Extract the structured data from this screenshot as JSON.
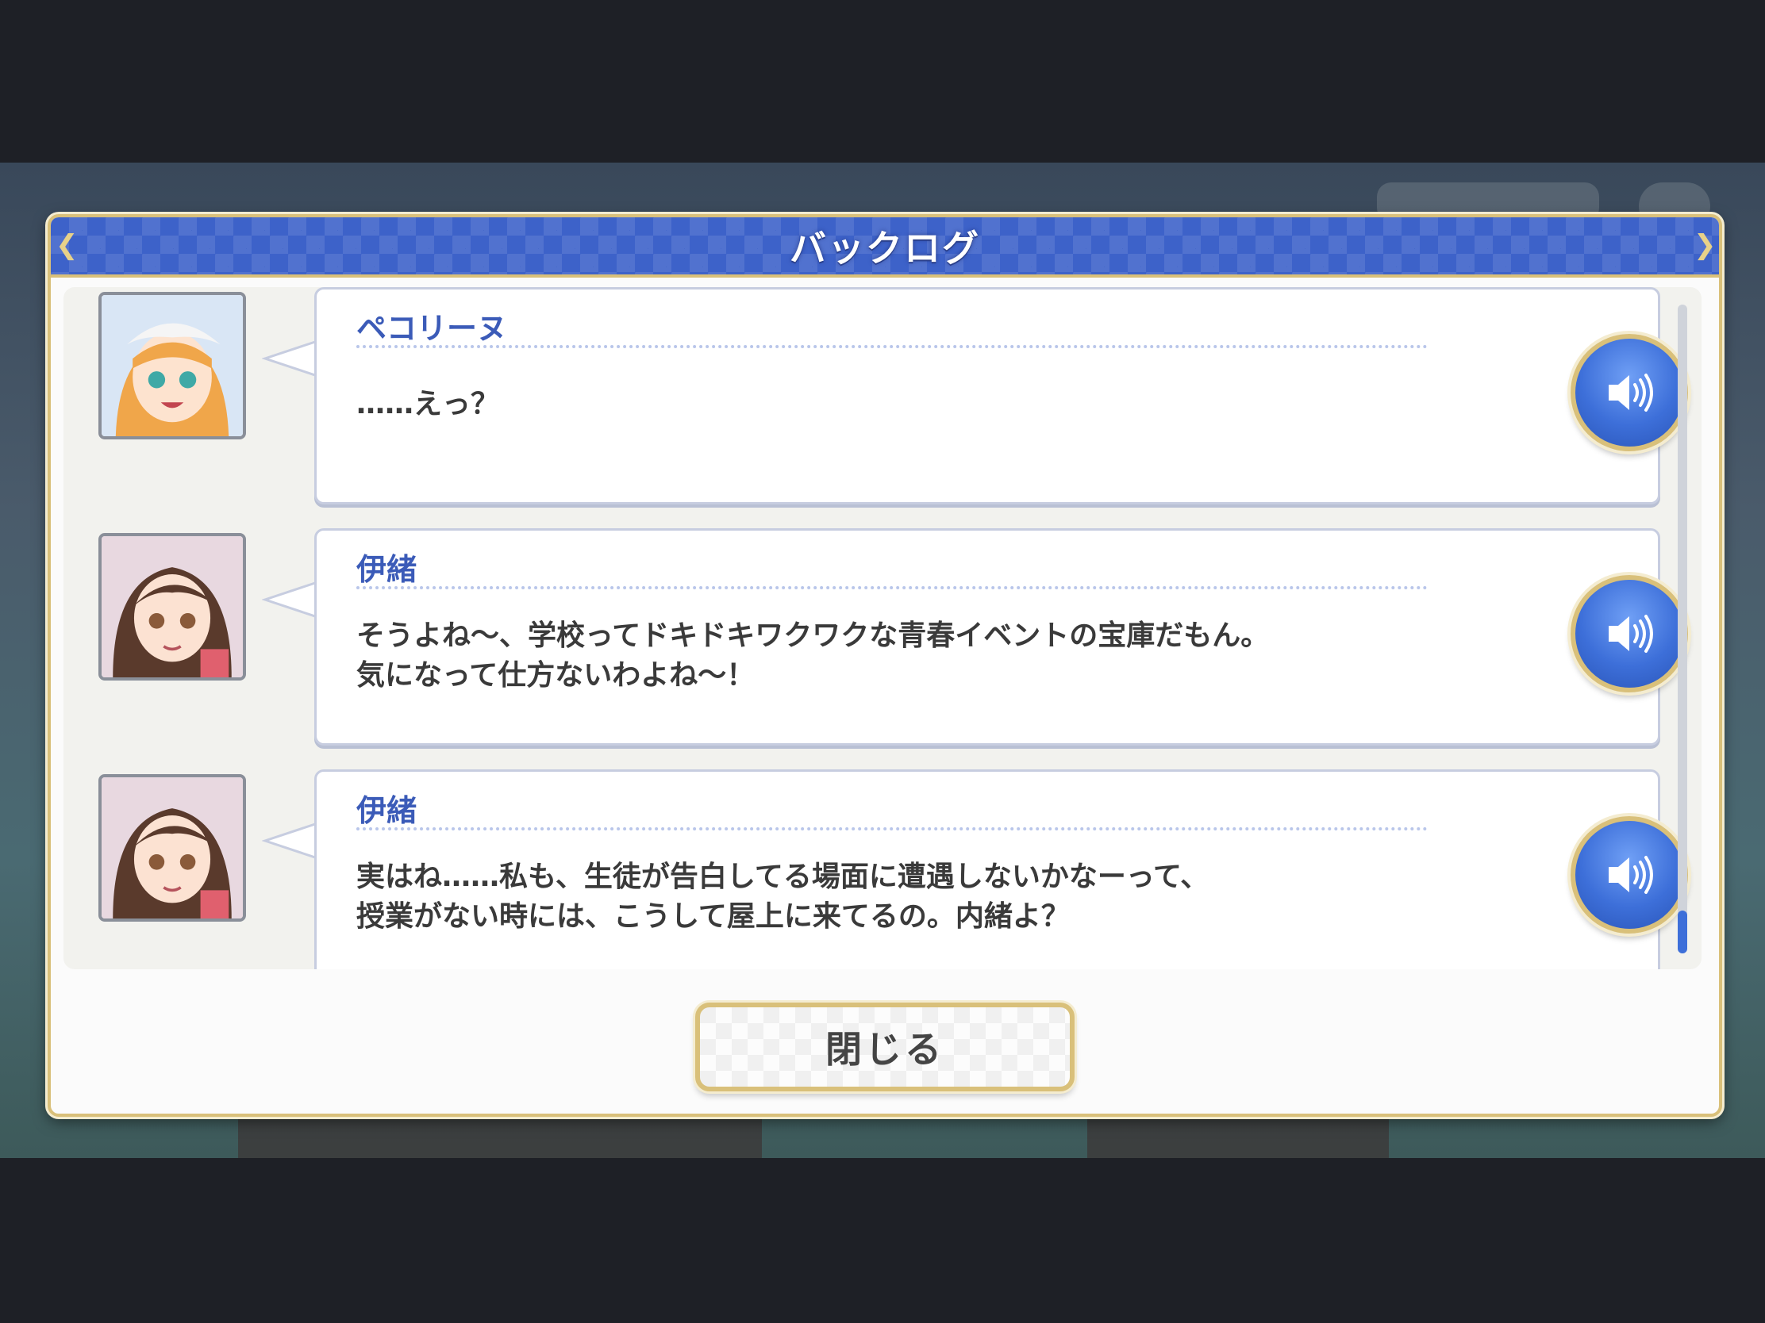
{
  "dialog": {
    "title": "バックログ",
    "close_label": "閉じる"
  },
  "entries": [
    {
      "speaker": "ペコリーヌ",
      "message": "……えっ？",
      "avatar": "pecorine-portrait",
      "voice_icon": "speaker-volume-icon"
    },
    {
      "speaker": "伊緒",
      "message": "そうよね～、学校ってドキドキワクワクな青春イベントの宝庫だもん。\n気になって仕方ないわよね～！",
      "avatar": "io-portrait",
      "voice_icon": "speaker-volume-icon"
    },
    {
      "speaker": "伊緒",
      "message": "実はね……私も、生徒が告白してる場面に遭遇しないかなーって、\n授業がない時には、こうして屋上に来てるの。内緒よ？",
      "avatar": "io-portrait",
      "voice_icon": "speaker-volume-icon"
    }
  ],
  "colors": {
    "header_blue": "#3d62c9",
    "gold_border": "#d9c07a",
    "speaker_blue": "#3b5bb8",
    "voice_button_blue": "#3d6fd9"
  }
}
